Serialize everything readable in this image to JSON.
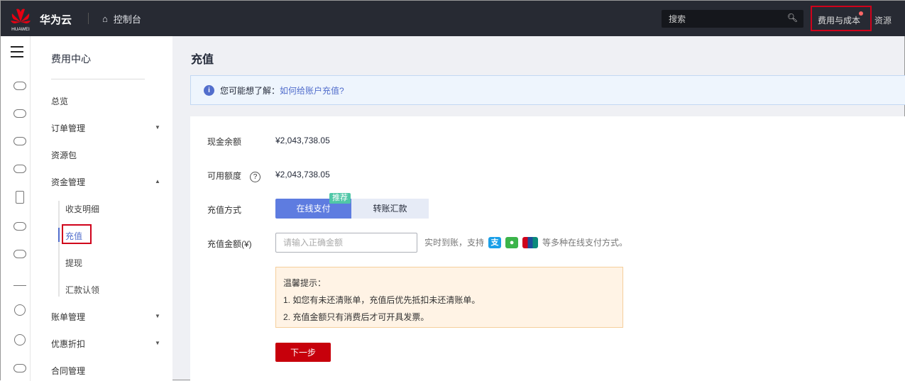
{
  "header": {
    "brand": "华为云",
    "logo_text": "HUAWEI",
    "console": "控制台",
    "search_placeholder": "搜索",
    "fee_cost": "费用与成本",
    "resources": "资源"
  },
  "menu": {
    "title": "费用中心",
    "items": [
      {
        "label": "总览"
      },
      {
        "label": "订单管理",
        "arrow": "▼"
      },
      {
        "label": "资源包"
      },
      {
        "label": "资金管理",
        "arrow": "▲"
      }
    ],
    "sub": [
      "收支明细",
      "充值",
      "提现",
      "汇款认领"
    ],
    "items2": [
      {
        "label": "账单管理",
        "arrow": "▼"
      },
      {
        "label": "优惠折扣",
        "arrow": "▼"
      },
      {
        "label": "合同管理"
      }
    ]
  },
  "page": {
    "title": "充值",
    "info_prefix": "您可能想了解：",
    "info_link": "如何给账户充值?",
    "cash_label": "现金余额",
    "cash_value": "¥2,043,738.05",
    "avail_label": "可用额度",
    "avail_value": "¥2,043,738.05",
    "method_label": "充值方式",
    "method_online": "在线支付",
    "method_badge": "推荐",
    "method_transfer": "转账汇款",
    "amount_label": "充值金额(¥)",
    "amount_placeholder": "请输入正确金额",
    "amount_value": "",
    "pay_prefix": "实时到账，支持",
    "pay_suffix": "等多种在线支付方式。",
    "tip_title": "温馨提示：",
    "tip_1": "1. 如您有未还清账单，充值后优先抵扣未还清账单。",
    "tip_2": "2. 充值金额只有消费后才可开具发票。",
    "next": "下一步"
  },
  "colors": {
    "accent": "#5e7ce0",
    "primary_button": "#c7000b",
    "highlight_box": "#d0021b"
  }
}
